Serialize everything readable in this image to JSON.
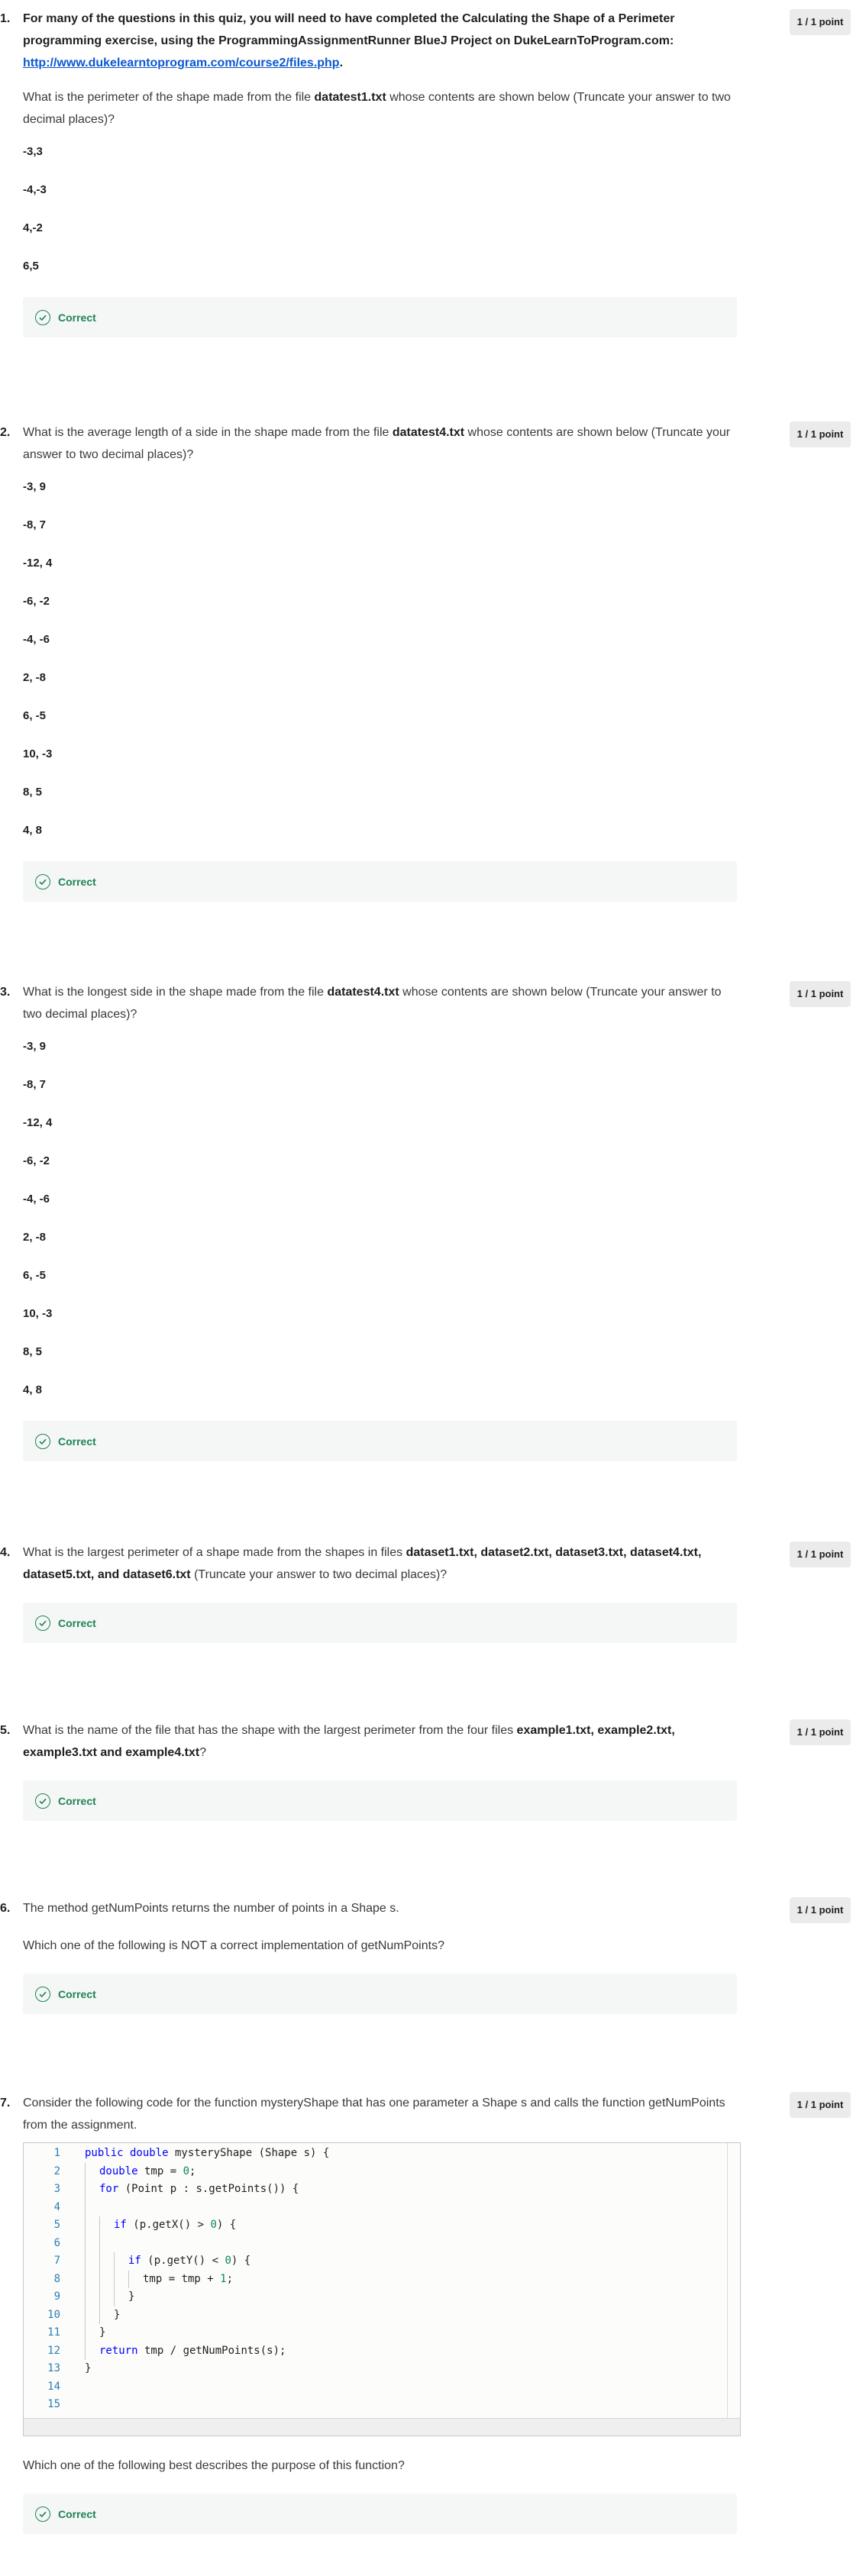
{
  "badge_label": "1 / 1 point",
  "correct_label": "Correct",
  "q1": {
    "number": "1.",
    "intro_a": "For many of the questions in this quiz, you will need to have completed the Calculating the Shape of a Perimeter programming exercise, using the ProgrammingAssignmentRunner BlueJ Project on DukeLearnToProgram.com: ",
    "intro_link": "http://www.dukelearntoprogram.com/course2/files.php",
    "intro_b": ".",
    "prompt_a": "What is the perimeter of the shape made from the file ",
    "prompt_file": "datatest1.txt",
    "prompt_b": " whose contents are shown below (Truncate your answer to two decimal places)?",
    "points": [
      "-3,3",
      "-4,-3",
      "4,-2",
      "6,5"
    ]
  },
  "q2": {
    "number": "2.",
    "prompt_a": "What is the average length of a side in the shape made from the file ",
    "prompt_file": "datatest4.txt",
    "prompt_b": " whose contents are shown below (Truncate your answer to two decimal places)?",
    "points": [
      "-3, 9",
      "-8, 7",
      "-12, 4",
      "-6, -2",
      "-4, -6",
      "2, -8",
      "6, -5",
      "10, -3",
      "8, 5",
      "4, 8"
    ]
  },
  "q3": {
    "number": "3.",
    "prompt_a": "What is the longest side in the shape made from the file ",
    "prompt_file": "datatest4.txt",
    "prompt_b": " whose contents are shown below (Truncate your answer to two decimal places)?",
    "points": [
      "-3, 9",
      "-8, 7",
      "-12, 4",
      "-6, -2",
      "-4, -6",
      "2, -8",
      "6, -5",
      "10, -3",
      "8, 5",
      "4, 8"
    ]
  },
  "q4": {
    "number": "4.",
    "prompt_a": "What is the largest perimeter of a shape made from the shapes in files ",
    "prompt_files": "dataset1.txt, dataset2.txt, dataset3.txt, dataset4.txt, dataset5.txt, and dataset6.txt",
    "prompt_b": " (Truncate your answer to two decimal places)?"
  },
  "q5": {
    "number": "5.",
    "prompt_a": "What is the name of the file that has the shape with the largest perimeter from the four files ",
    "prompt_files": "example1.txt, example2.txt, example3.txt and example4.txt",
    "prompt_b": "?"
  },
  "q6": {
    "number": "6.",
    "prompt_a": "The method getNumPoints returns the number of points in a Shape s.",
    "prompt_b": "Which one of the following is NOT a correct implementation of getNumPoints?"
  },
  "q7": {
    "number": "7.",
    "prompt_a": "Consider the following code for the function mysteryShape that has one parameter a Shape s and calls the function getNumPoints from the assignment.",
    "prompt_b": "Which one of the following best describes the purpose of this function?",
    "line_numbers": [
      "1",
      "2",
      "3",
      "4",
      "5",
      "6",
      "7",
      "8",
      "9",
      "10",
      "11",
      "12",
      "13",
      "14",
      "15"
    ],
    "code": {
      "l1_kw": "public double",
      "l1_rest": " mysteryShape (Shape s) {",
      "l2_kw": "double",
      "l2_rest": " tmp = ",
      "l2_num": "0",
      "l2_end": ";",
      "l3_kw": "for",
      "l3_rest": " (Point p : s.getPoints()) {",
      "l5_kw": "if",
      "l5_rest": " (p.getX() > ",
      "l5_num": "0",
      "l5_end": ") {",
      "l7_kw": "if",
      "l7_rest": " (p.getY() < ",
      "l7_num": "0",
      "l7_end": ") {",
      "l8_rest": "tmp = tmp + ",
      "l8_num": "1",
      "l8_end": ";",
      "l9": "}",
      "l10": "}",
      "l11": "}",
      "l12_kw": "return",
      "l12_rest": " tmp / getNumPoints(s);",
      "l13": "}"
    }
  }
}
